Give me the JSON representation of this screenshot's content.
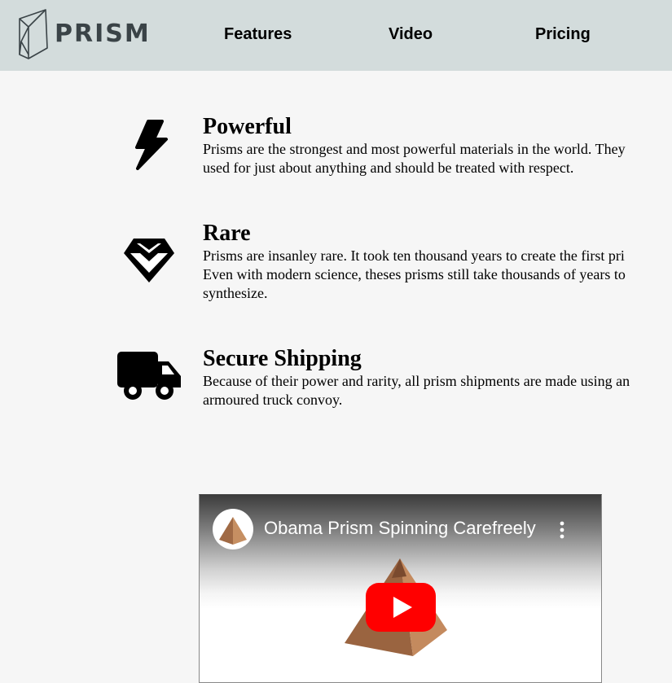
{
  "header": {
    "logo_text": "PRISM",
    "nav": [
      {
        "label": "Features"
      },
      {
        "label": "Video"
      },
      {
        "label": "Pricing"
      }
    ]
  },
  "features": [
    {
      "icon": "lightning-bolt-icon",
      "title": "Powerful",
      "description": "Prisms are the strongest and most powerful materials in the world. They\nused for just about anything and should be treated with respect."
    },
    {
      "icon": "diamond-icon",
      "title": "Rare",
      "description": "Prisms are insanley rare. It took ten thousand years to create the first pri\nEven with modern science, theses prisms still take thousands of years to\nsynthesize."
    },
    {
      "icon": "truck-icon",
      "title": "Secure Shipping",
      "description": "Because of their power and rarity, all prism shipments are made using an\narmoured truck convoy."
    }
  ],
  "video": {
    "title": "Obama Prism Spinning Carefreely",
    "channel_avatar": "pyramid-avatar-icon",
    "menu_icon": "more-vert-icon",
    "play_icon": "youtube-play-icon",
    "colors": {
      "play": "#ff0000",
      "pyramid": "#b07a52"
    }
  }
}
